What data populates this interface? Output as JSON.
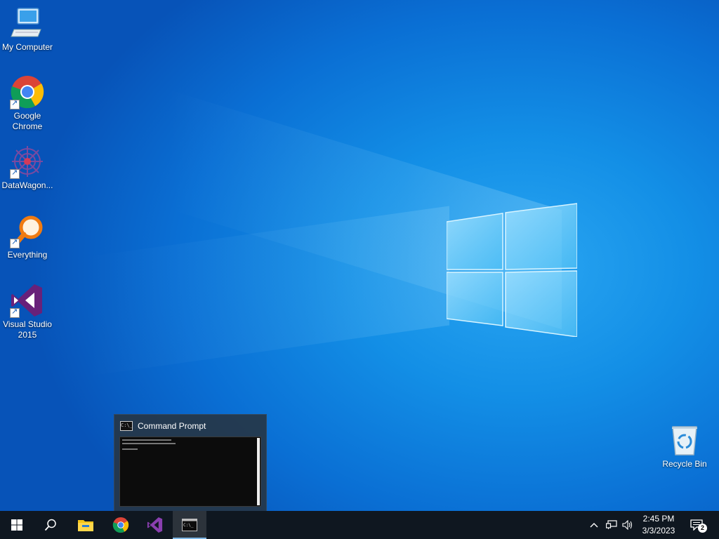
{
  "desktop": {
    "icons": [
      {
        "id": "my-computer",
        "label": "My Computer",
        "icon": "computer-icon"
      },
      {
        "id": "google-chrome",
        "label": "Google Chrome",
        "icon": "chrome-icon",
        "shortcut": true
      },
      {
        "id": "datawagon",
        "label": "DataWagon...",
        "icon": "datawagon-icon",
        "shortcut": true
      },
      {
        "id": "everything",
        "label": "Everything",
        "icon": "everything-search-icon",
        "shortcut": true
      },
      {
        "id": "visual-studio",
        "label": "Visual Studio 2015",
        "icon": "visual-studio-icon",
        "shortcut": true
      },
      {
        "id": "recycle-bin",
        "label": "Recycle Bin",
        "icon": "recycle-bin-icon"
      }
    ]
  },
  "taskbar_preview": {
    "title": "Command Prompt",
    "icon": "command-prompt-icon",
    "icon_text": "C:\\_"
  },
  "taskbar": {
    "buttons": [
      {
        "id": "start",
        "icon": "windows-start-icon"
      },
      {
        "id": "search",
        "icon": "search-icon"
      },
      {
        "id": "file-explorer",
        "icon": "folder-icon"
      },
      {
        "id": "chrome",
        "icon": "chrome-icon"
      },
      {
        "id": "visual-studio",
        "icon": "visual-studio-icon"
      },
      {
        "id": "command-prompt",
        "icon": "command-prompt-icon",
        "active": true
      }
    ],
    "tray": {
      "chevron": "^",
      "icons": [
        "chevron-up-icon",
        "network-icon",
        "volume-icon"
      ],
      "time": "2:45 PM",
      "date": "3/3/2023",
      "notification_count": "2"
    }
  },
  "colors": {
    "wallpaper_primary": "#0a6fd4",
    "wallpaper_highlight": "#2aa6f2",
    "taskbar": "#0f1720",
    "preview_bg": "#263646",
    "vs_purple": "#68217a"
  }
}
